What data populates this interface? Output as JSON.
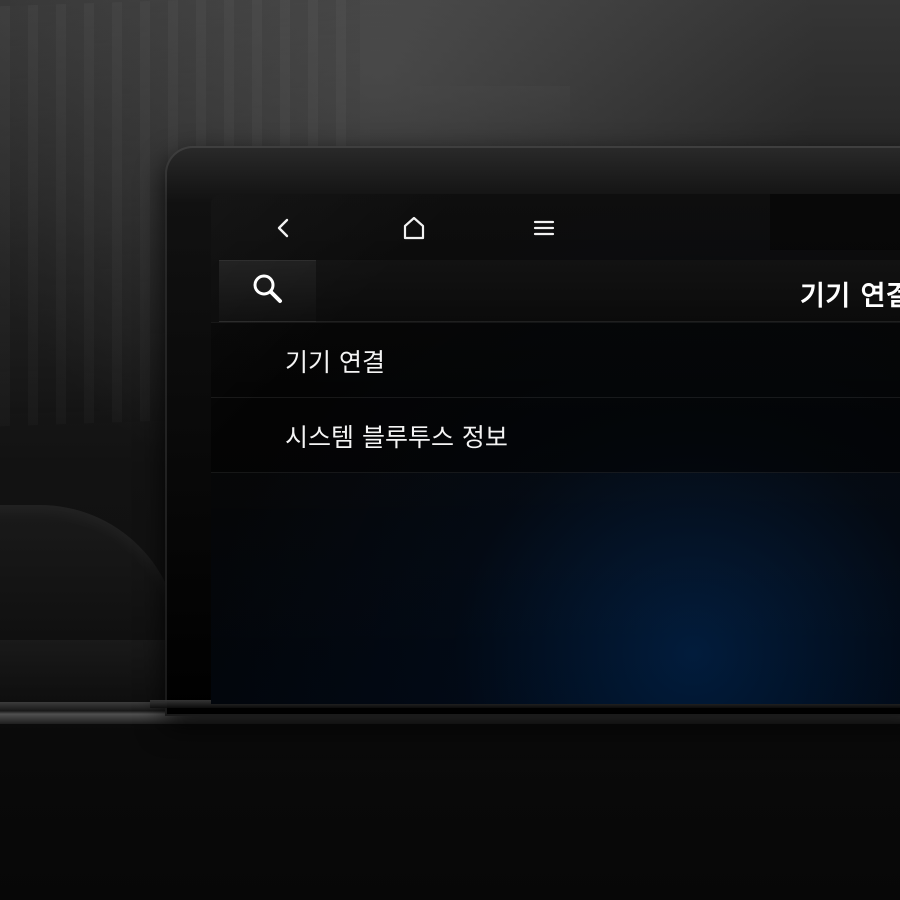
{
  "navigation": {
    "back_icon": "chevron-left-icon",
    "home_icon": "home-icon",
    "menu_icon": "hamburger-menu-icon"
  },
  "header": {
    "search_icon": "search-icon",
    "title": "기기 연결"
  },
  "list": {
    "items": [
      {
        "label": "기기 연결"
      },
      {
        "label": "시스템 블루투스 정보"
      }
    ]
  },
  "colors": {
    "text": "#FFFFFF",
    "screen_blue_glow": "#003778"
  }
}
